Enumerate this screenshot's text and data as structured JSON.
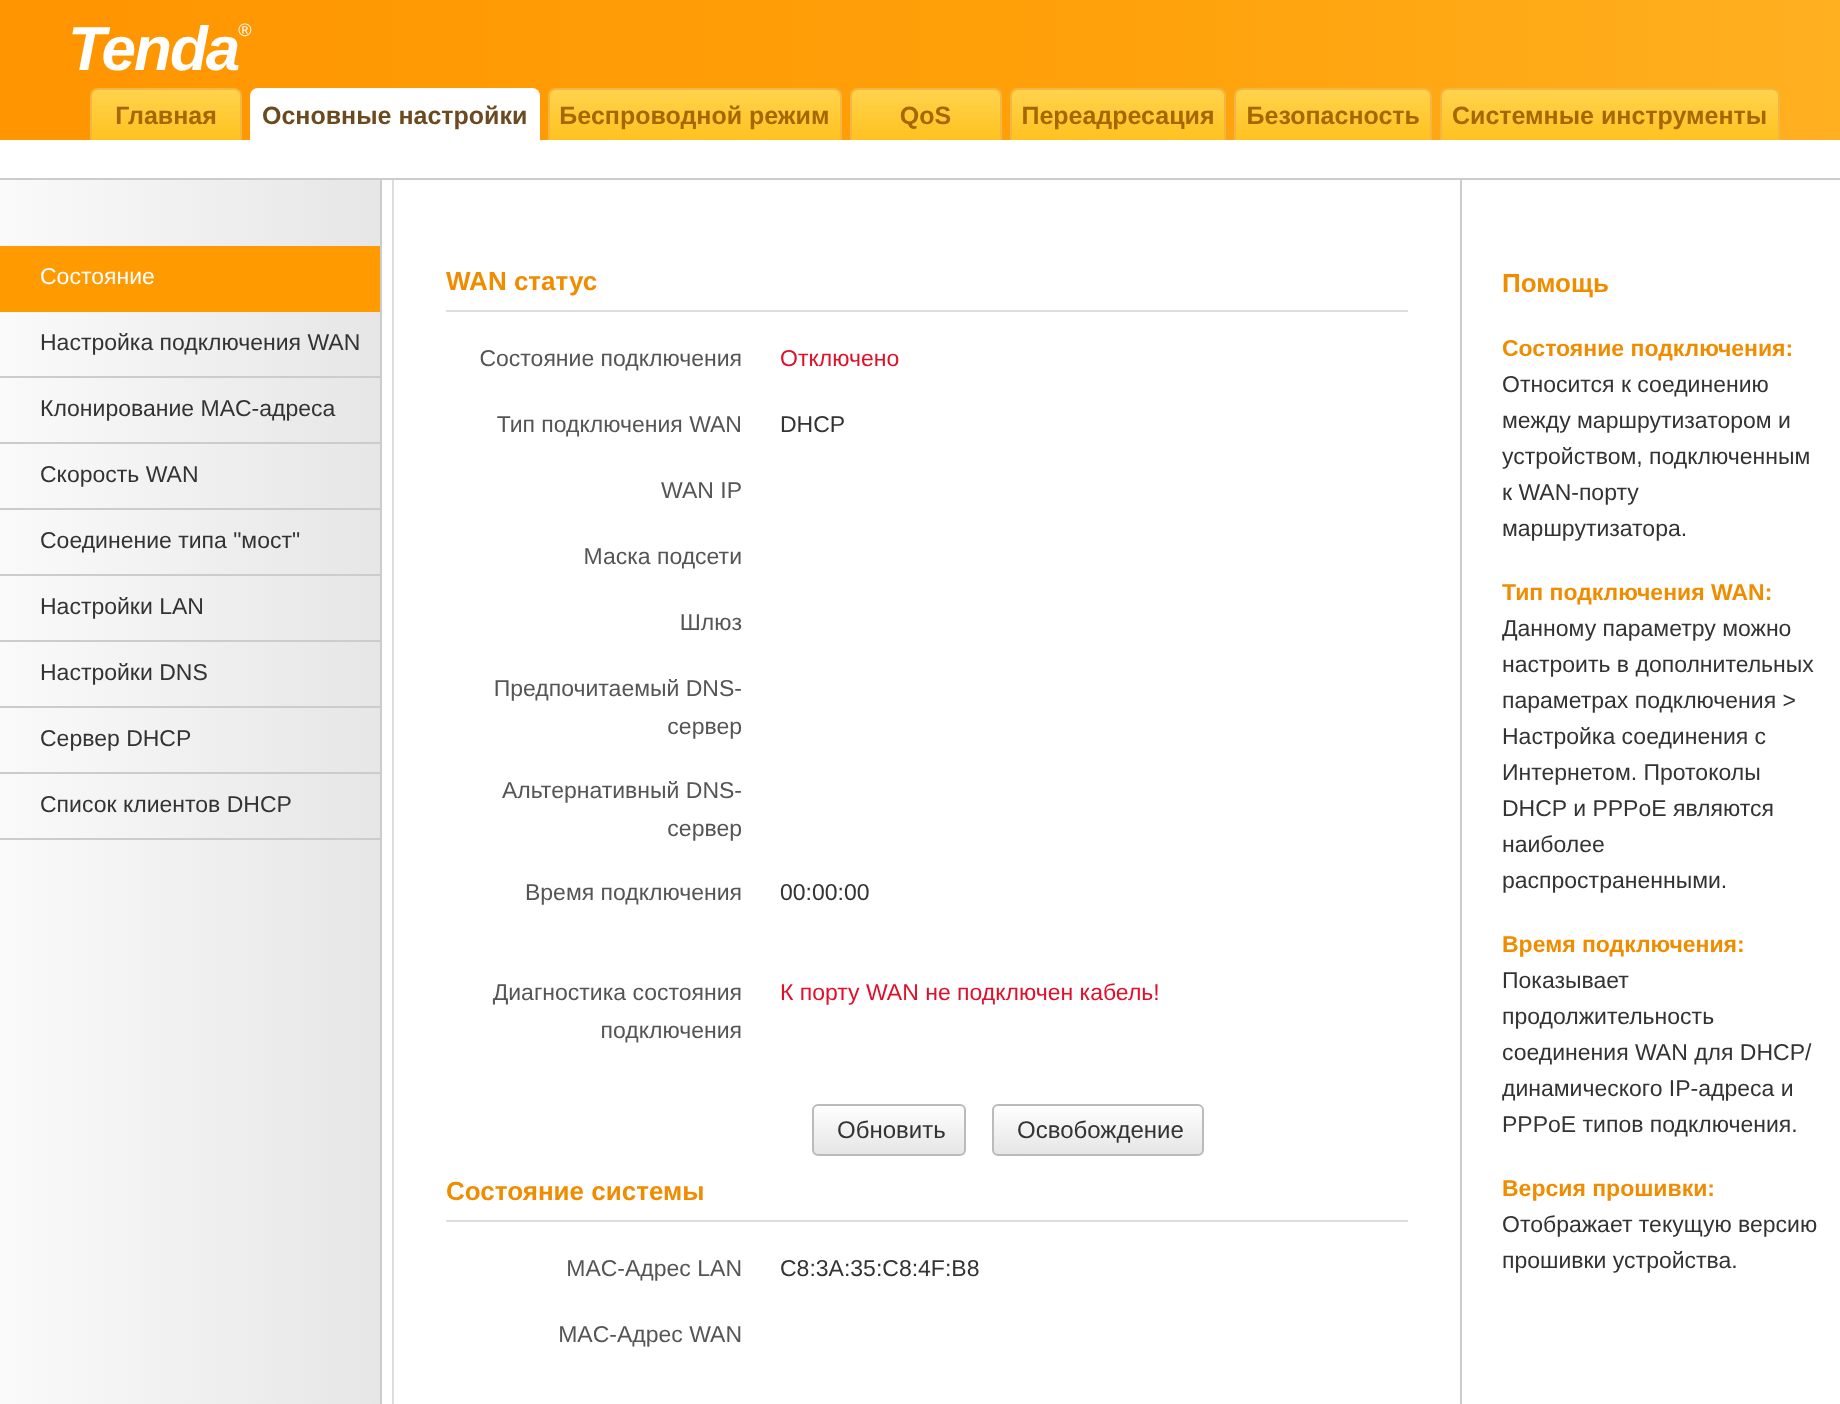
{
  "header": {
    "logo": "Tenda",
    "logo_mark": "®"
  },
  "tabs": [
    {
      "label": "Главная",
      "selected": false
    },
    {
      "label": "Основные настройки",
      "selected": true
    },
    {
      "label": "Беспроводной режим",
      "selected": false
    },
    {
      "label": "QoS",
      "selected": false
    },
    {
      "label": "Переадресация",
      "selected": false
    },
    {
      "label": "Безопасность",
      "selected": false
    },
    {
      "label": "Системные инструменты",
      "selected": false
    }
  ],
  "sidebar": {
    "items": [
      {
        "label": "Состояние",
        "selected": true
      },
      {
        "label": "Настройка подключения WAN",
        "selected": false
      },
      {
        "label": "Клонирование MAC-адреса",
        "selected": false
      },
      {
        "label": "Скорость WAN",
        "selected": false
      },
      {
        "label": "Соединение типа \"мост\"",
        "selected": false
      },
      {
        "label": "Настройки LAN",
        "selected": false
      },
      {
        "label": "Настройки DNS",
        "selected": false
      },
      {
        "label": "Сервер DHCP",
        "selected": false
      },
      {
        "label": "Список клиентов DHCP",
        "selected": false
      }
    ]
  },
  "wan_status": {
    "title": "WAN статус",
    "rows": [
      {
        "label": "Состояние подключения",
        "value": "Отключено",
        "kind": "error"
      },
      {
        "label": "Тип подключения WAN",
        "value": "DHCP",
        "kind": "normal"
      },
      {
        "label": "WAN IP"
      },
      {
        "label": "Маска подсети"
      },
      {
        "label": "Шлюз"
      },
      {
        "label": "Предпочитаемый DNS-сервер"
      },
      {
        "label": "Альтернативный DNS-сервер"
      },
      {
        "label": "Время подключения",
        "value": "00:00:00",
        "kind": "normal"
      },
      {
        "label": "Диагностика состояния подключения",
        "value": "К порту WAN не подключен кабель!",
        "kind": "error"
      }
    ],
    "buttons": [
      "Обновить",
      "Освобождение"
    ]
  },
  "system_status": {
    "title": "Состояние системы",
    "rows": [
      {
        "label": "MAC-Адрес LAN",
        "value": "C8:3A:35:C8:4F:B8",
        "kind": "normal"
      },
      {
        "label": "MAC-Адрес WAN"
      }
    ]
  },
  "help": {
    "title": "Помощь",
    "sections": [
      {
        "heading": "Состояние подключения:",
        "text": "Относится к соединению между маршрутизатором и устройством, подключенным к WAN-порту маршрутизатора."
      },
      {
        "heading": "Тип подключения WAN:",
        "text": "Данному параметру можно настроить в дополнительных параметрах подключения > Настройка соединения с Интернетом. Протоколы DHCP и PPPoE являются наиболее распространенными."
      },
      {
        "heading": "Время подключения:",
        "text": "Показывает продолжительность соединения WAN для DHCP/ динамического IP-адреса и PPPoE типов подключения."
      },
      {
        "heading": "Версия прошивки:",
        "text": "Отображает текущую версию прошивки устройства."
      }
    ]
  }
}
